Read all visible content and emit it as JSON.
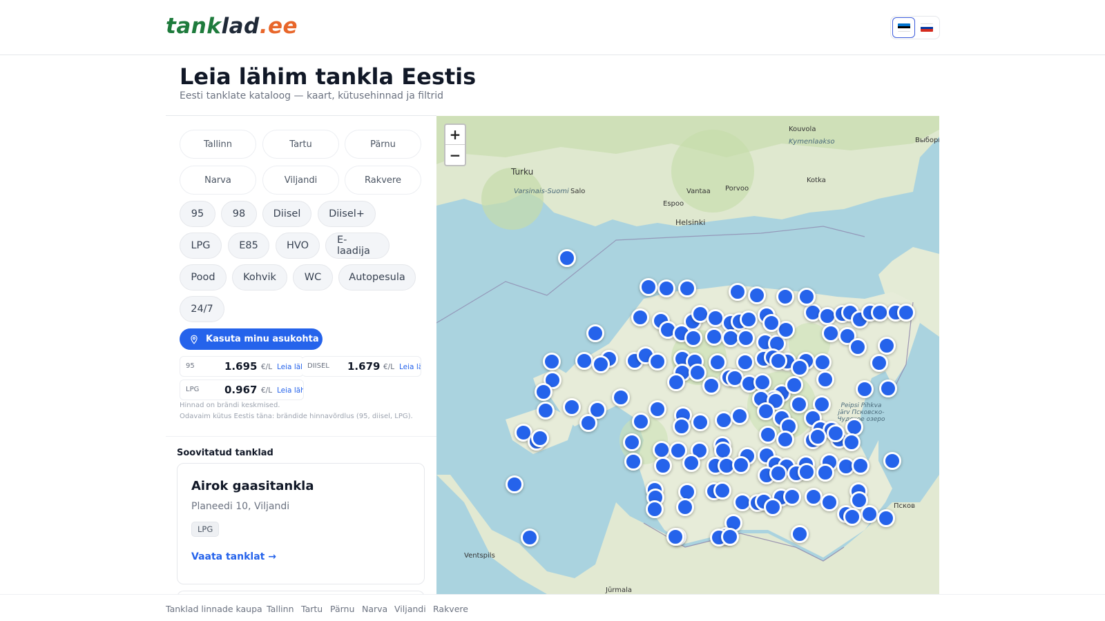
{
  "header": {
    "logo_part1": "tank",
    "logo_part2": "lad",
    "logo_part3": ".ee",
    "languages": [
      {
        "code": "et",
        "active": true,
        "colors": [
          "#0072ce",
          "#000000",
          "#ffffff"
        ]
      },
      {
        "code": "ru",
        "active": false,
        "colors": [
          "#ffffff",
          "#0039a6",
          "#d52b1e"
        ]
      }
    ]
  },
  "page": {
    "title": "Leia lähim tankla Eestis",
    "subtitle": "Eesti tanklate kataloog — kaart, kütusehinnad ja filtrid"
  },
  "cities": [
    "Tallinn",
    "Tartu",
    "Pärnu",
    "Narva",
    "Viljandi",
    "Rakvere"
  ],
  "filters": {
    "row1": [
      "95",
      "98",
      "Diisel",
      "Diisel+"
    ],
    "row2": [
      "LPG",
      "E85",
      "HVO",
      "E-laadija"
    ],
    "row3": [
      "Pood",
      "Kohvik",
      "WC",
      "Autopesula"
    ],
    "row4": [
      "24/7"
    ]
  },
  "location_button": "Kasuta minu asukohta",
  "prices": [
    {
      "label": "95",
      "value": "1.695",
      "unit": "€/L",
      "link": "Leia lähim →"
    },
    {
      "label": "DIISEL",
      "value": "1.679",
      "unit": "€/L",
      "link": "Leia lähim →"
    },
    {
      "label": "LPG",
      "value": "0.967",
      "unit": "€/L",
      "link": "Leia lähim →"
    }
  ],
  "notes": {
    "line1": "Hinnad on brändi keskmised.",
    "line2": "Odavaim kütus Eestis täna: brändide hinnavõrdlus (95, diisel, LPG)."
  },
  "recommended": {
    "heading": "Soovitatud tanklad",
    "card": {
      "name": "Airok gaasitankla",
      "address": "Planeedi 10, Viljandi",
      "tag": "LPG",
      "link": "Vaata tanklat →"
    }
  },
  "map": {
    "zoom_in": "+",
    "zoom_out": "−",
    "labels": [
      "Kouvola",
      "Kymenlaakso",
      "Выборг",
      "Turku",
      "Varsinais-Suomi",
      "Salo",
      "Vantaa",
      "Porvoo",
      "Kotka",
      "Espoo",
      "Helsinki",
      "Ventspils",
      "Псков",
      "Peipsi Pihkva järv Псковско-Чудское озеро",
      "Jūrmala"
    ],
    "marker_color": "#2563eb"
  },
  "footer": {
    "links": [
      "Tanklad linnade kaupa",
      "Tallinn",
      "Tartu",
      "Pärnu",
      "Narva",
      "Viljandi",
      "Rakvere"
    ]
  }
}
